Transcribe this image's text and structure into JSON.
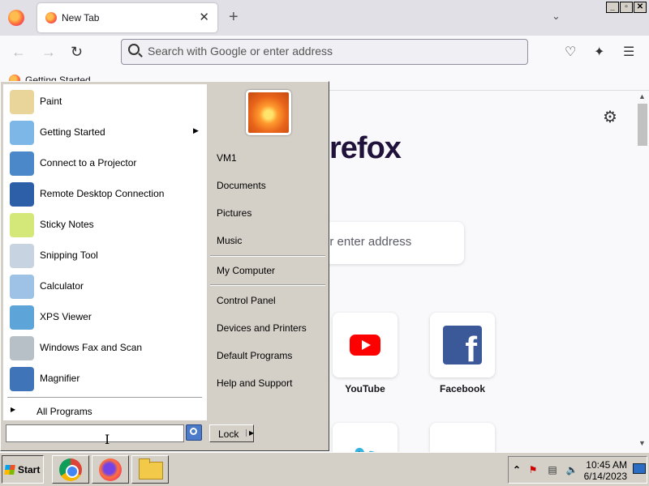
{
  "browser": {
    "tab_title": "New Tab",
    "tab_close": "✕",
    "new_tab": "+",
    "list_tabs": "⌄",
    "window_controls": [
      "_",
      "▫",
      "✕"
    ],
    "nav": {
      "back": "←",
      "forward": "→",
      "reload": "↻"
    },
    "url_placeholder": "Search with Google or enter address",
    "toolbar_icons": {
      "pocket": "♡",
      "extensions": "✦",
      "menu": "☰"
    },
    "bookmark_label": "Getting Started",
    "content": {
      "settings": "⚙",
      "brand_text": "refox",
      "search_placeholder": "or enter address",
      "tiles": [
        {
          "label": "YouTube"
        },
        {
          "label": "Facebook"
        }
      ],
      "twitter_glyph": "🐦"
    },
    "scroll": {
      "up": "▲",
      "down": "▼"
    }
  },
  "start_menu": {
    "programs": [
      {
        "label": "Paint",
        "color": "#e9d49a",
        "has_submenu": false
      },
      {
        "label": "Getting Started",
        "color": "#7db7e8",
        "has_submenu": true
      },
      {
        "label": "Connect to a Projector",
        "color": "#4a88c9",
        "has_submenu": false
      },
      {
        "label": "Remote Desktop Connection",
        "color": "#2c5fa8",
        "has_submenu": false
      },
      {
        "label": "Sticky Notes",
        "color": "#d4e87a",
        "has_submenu": false
      },
      {
        "label": "Snipping Tool",
        "color": "#c7d3e0",
        "has_submenu": false
      },
      {
        "label": "Calculator",
        "color": "#9ec1e6",
        "has_submenu": false
      },
      {
        "label": "XPS Viewer",
        "color": "#5da4d9",
        "has_submenu": false
      },
      {
        "label": "Windows Fax and Scan",
        "color": "#b7bfc7",
        "has_submenu": false
      },
      {
        "label": "Magnifier",
        "color": "#3f74b8",
        "has_submenu": false
      }
    ],
    "submenu_arrow": "▶",
    "all_programs": "All Programs",
    "all_programs_arrow": "▶",
    "places_group1": [
      "VM1",
      "Documents",
      "Pictures",
      "Music"
    ],
    "places_group2": [
      "My Computer"
    ],
    "places_group3": [
      "Control Panel",
      "Devices and Printers",
      "Default Programs",
      "Help and Support"
    ],
    "search_value": "",
    "lock_label": "Lock",
    "lock_arrow": "▶",
    "cursor_glyph": "I"
  },
  "taskbar": {
    "start_label": "Start",
    "apps": [
      "Google Chrome",
      "Firefox",
      "Windows Explorer"
    ],
    "tray_expand": "⌃",
    "clock_time": "10:45 AM",
    "clock_date": "6/14/2023"
  }
}
